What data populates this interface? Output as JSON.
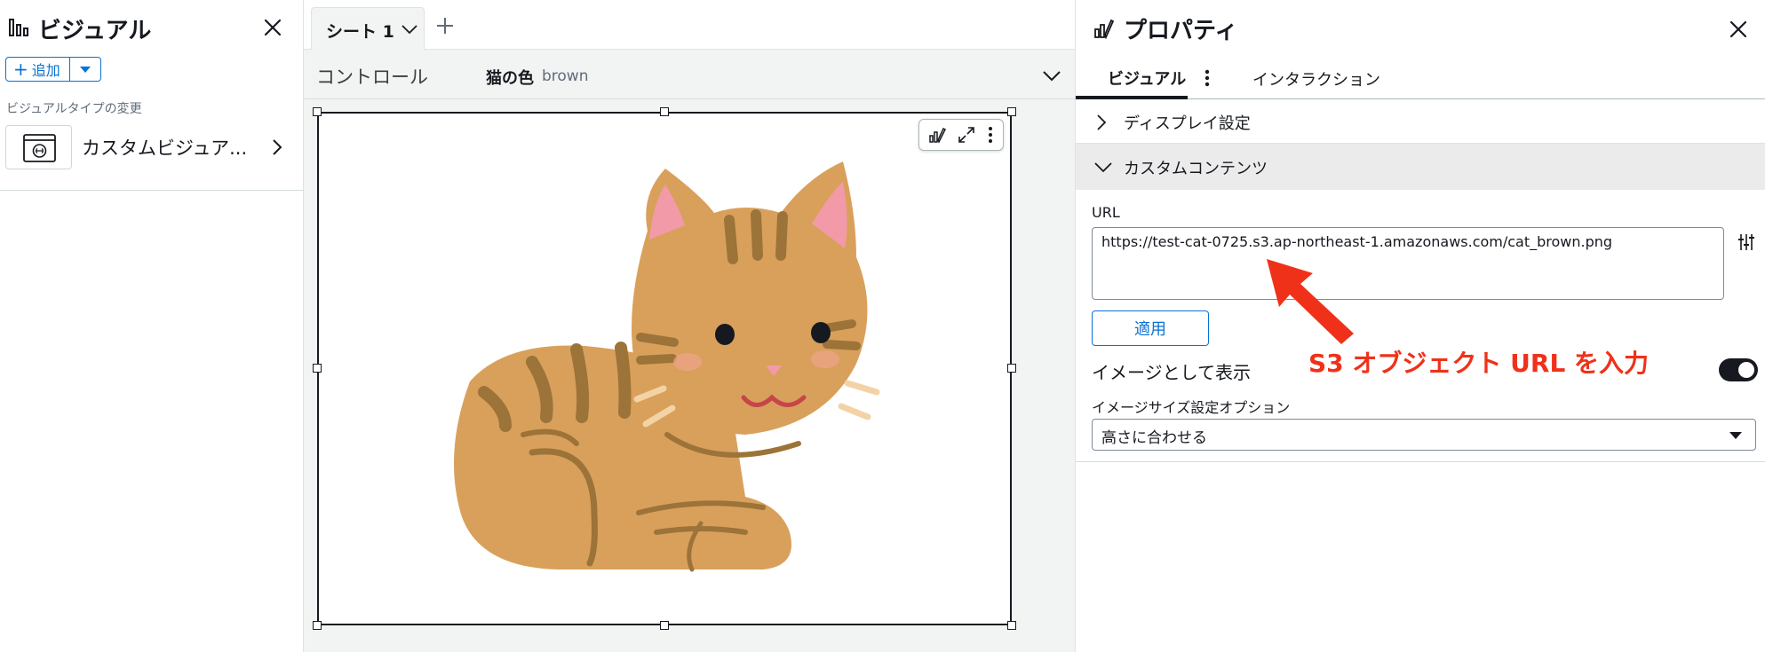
{
  "left_panel": {
    "title": "ビジュアル",
    "add_label": "追加",
    "visual_type_caption": "ビジュアルタイプの変更",
    "visual_type_label": "カスタムビジュア..."
  },
  "canvas": {
    "sheet_tab": "シート 1",
    "controls_label": "コントロール",
    "filter_name": "猫の色",
    "filter_value": "brown"
  },
  "right_panel": {
    "title": "プロパティ",
    "tab_visual": "ビジュアル",
    "tab_interaction": "インタラクション",
    "section_display": "ディスプレイ設定",
    "section_custom": "カスタムコンテンツ",
    "url_label": "URL",
    "url_value": "https://test-cat-0725.s3.ap-northeast-1.amazonaws.com/cat_brown.png",
    "apply_label": "適用",
    "show_as_image_label": "イメージとして表示",
    "show_as_image_on": true,
    "image_size_label": "イメージサイズ設定オプション",
    "image_size_value": "高さに合わせる"
  },
  "annotation": {
    "text": "S3 オブジェクト URL を入力",
    "color": "#f0311a"
  },
  "icons": [
    "bar-chart-icon",
    "close-icon",
    "plus-icon",
    "caret-down-icon",
    "custom-visual-icon",
    "chevron-right-icon",
    "chevron-down-icon",
    "format-icon",
    "expand-icon",
    "more-icon",
    "sliders-icon"
  ],
  "colors": {
    "accent": "#0972d3",
    "cat_fur": "#d9a05b",
    "cat_stripe": "#9c7338",
    "cat_ear": "#f29aa8"
  }
}
